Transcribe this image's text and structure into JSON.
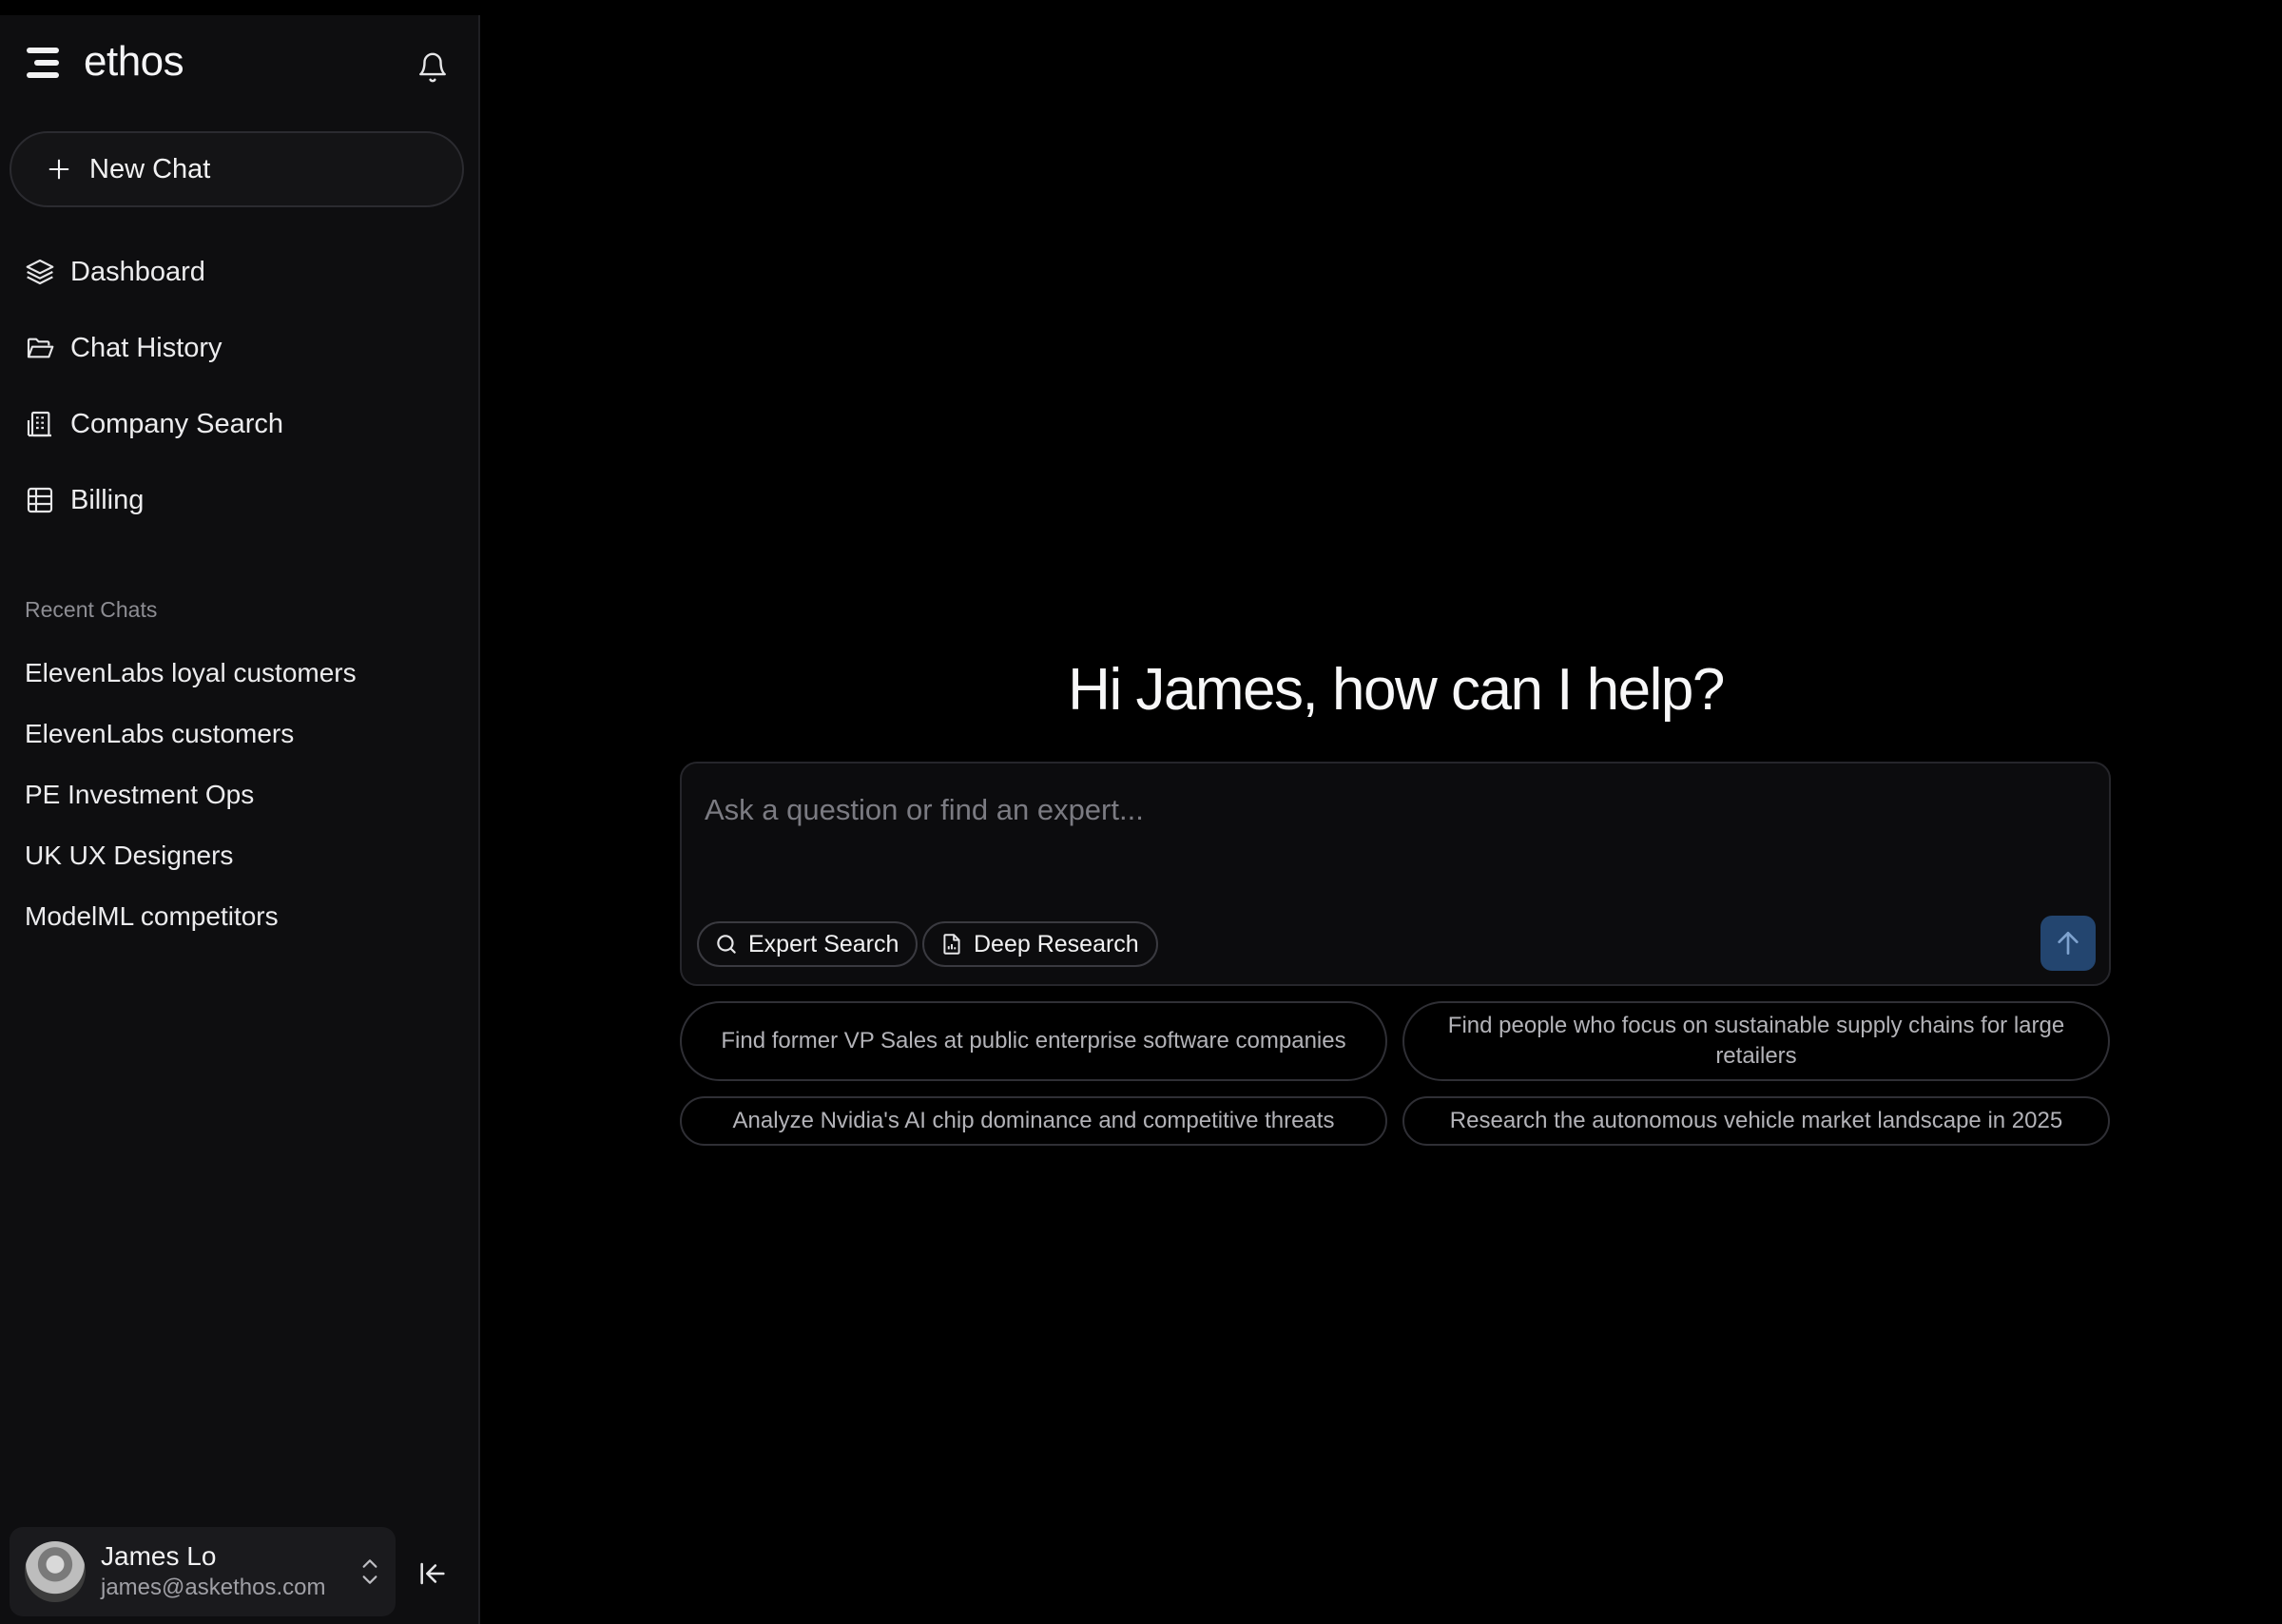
{
  "brand": {
    "name": "ethos"
  },
  "sidebar": {
    "new_chat_label": "New Chat",
    "nav": [
      {
        "label": "Dashboard",
        "icon": "layers-icon"
      },
      {
        "label": "Chat History",
        "icon": "folder-icon"
      },
      {
        "label": "Company Search",
        "icon": "building-icon"
      },
      {
        "label": "Billing",
        "icon": "table-icon"
      }
    ],
    "recent_title": "Recent Chats",
    "recent": [
      "ElevenLabs loyal customers",
      "ElevenLabs customers",
      "PE Investment Ops",
      "UK UX Designers",
      "ModelML competitors"
    ],
    "user": {
      "name": "James Lo",
      "email": "james@askethos.com"
    }
  },
  "main": {
    "greeting": "Hi James, how can I help?",
    "composer": {
      "placeholder": "Ask a question or find an expert...",
      "modes": [
        "Expert Search",
        "Deep Research"
      ]
    },
    "suggestions": [
      "Find former VP Sales at public enterprise software companies",
      "Find people who focus on sustainable supply chains for large retailers",
      "Analyze Nvidia's AI chip dominance and competitive threats",
      "Research the autonomous vehicle market landscape in 2025"
    ]
  },
  "colors": {
    "background": "#000000",
    "sidebar": "#0e0e10",
    "send_button": "#23456f"
  }
}
